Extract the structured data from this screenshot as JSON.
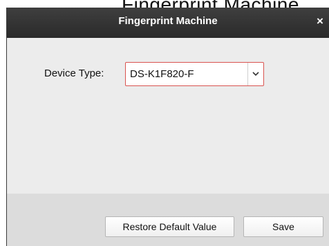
{
  "background_window": {
    "partial_title": "Fingerprint Machine"
  },
  "dialog": {
    "title": "Fingerprint Machine",
    "close_glyph": "×"
  },
  "form": {
    "device_type_label": "Device Type:",
    "device_type_value": "DS-K1F820-F"
  },
  "buttons": {
    "restore_label": "Restore Default Value",
    "save_label": "Save"
  },
  "icons": {
    "close": "close-icon",
    "dropdown": "chevron-down-icon"
  },
  "colors": {
    "titlebar": "#333333",
    "select_border": "#d9534f",
    "content_bg": "#ececec",
    "footer_bg": "#dcdcdc"
  }
}
